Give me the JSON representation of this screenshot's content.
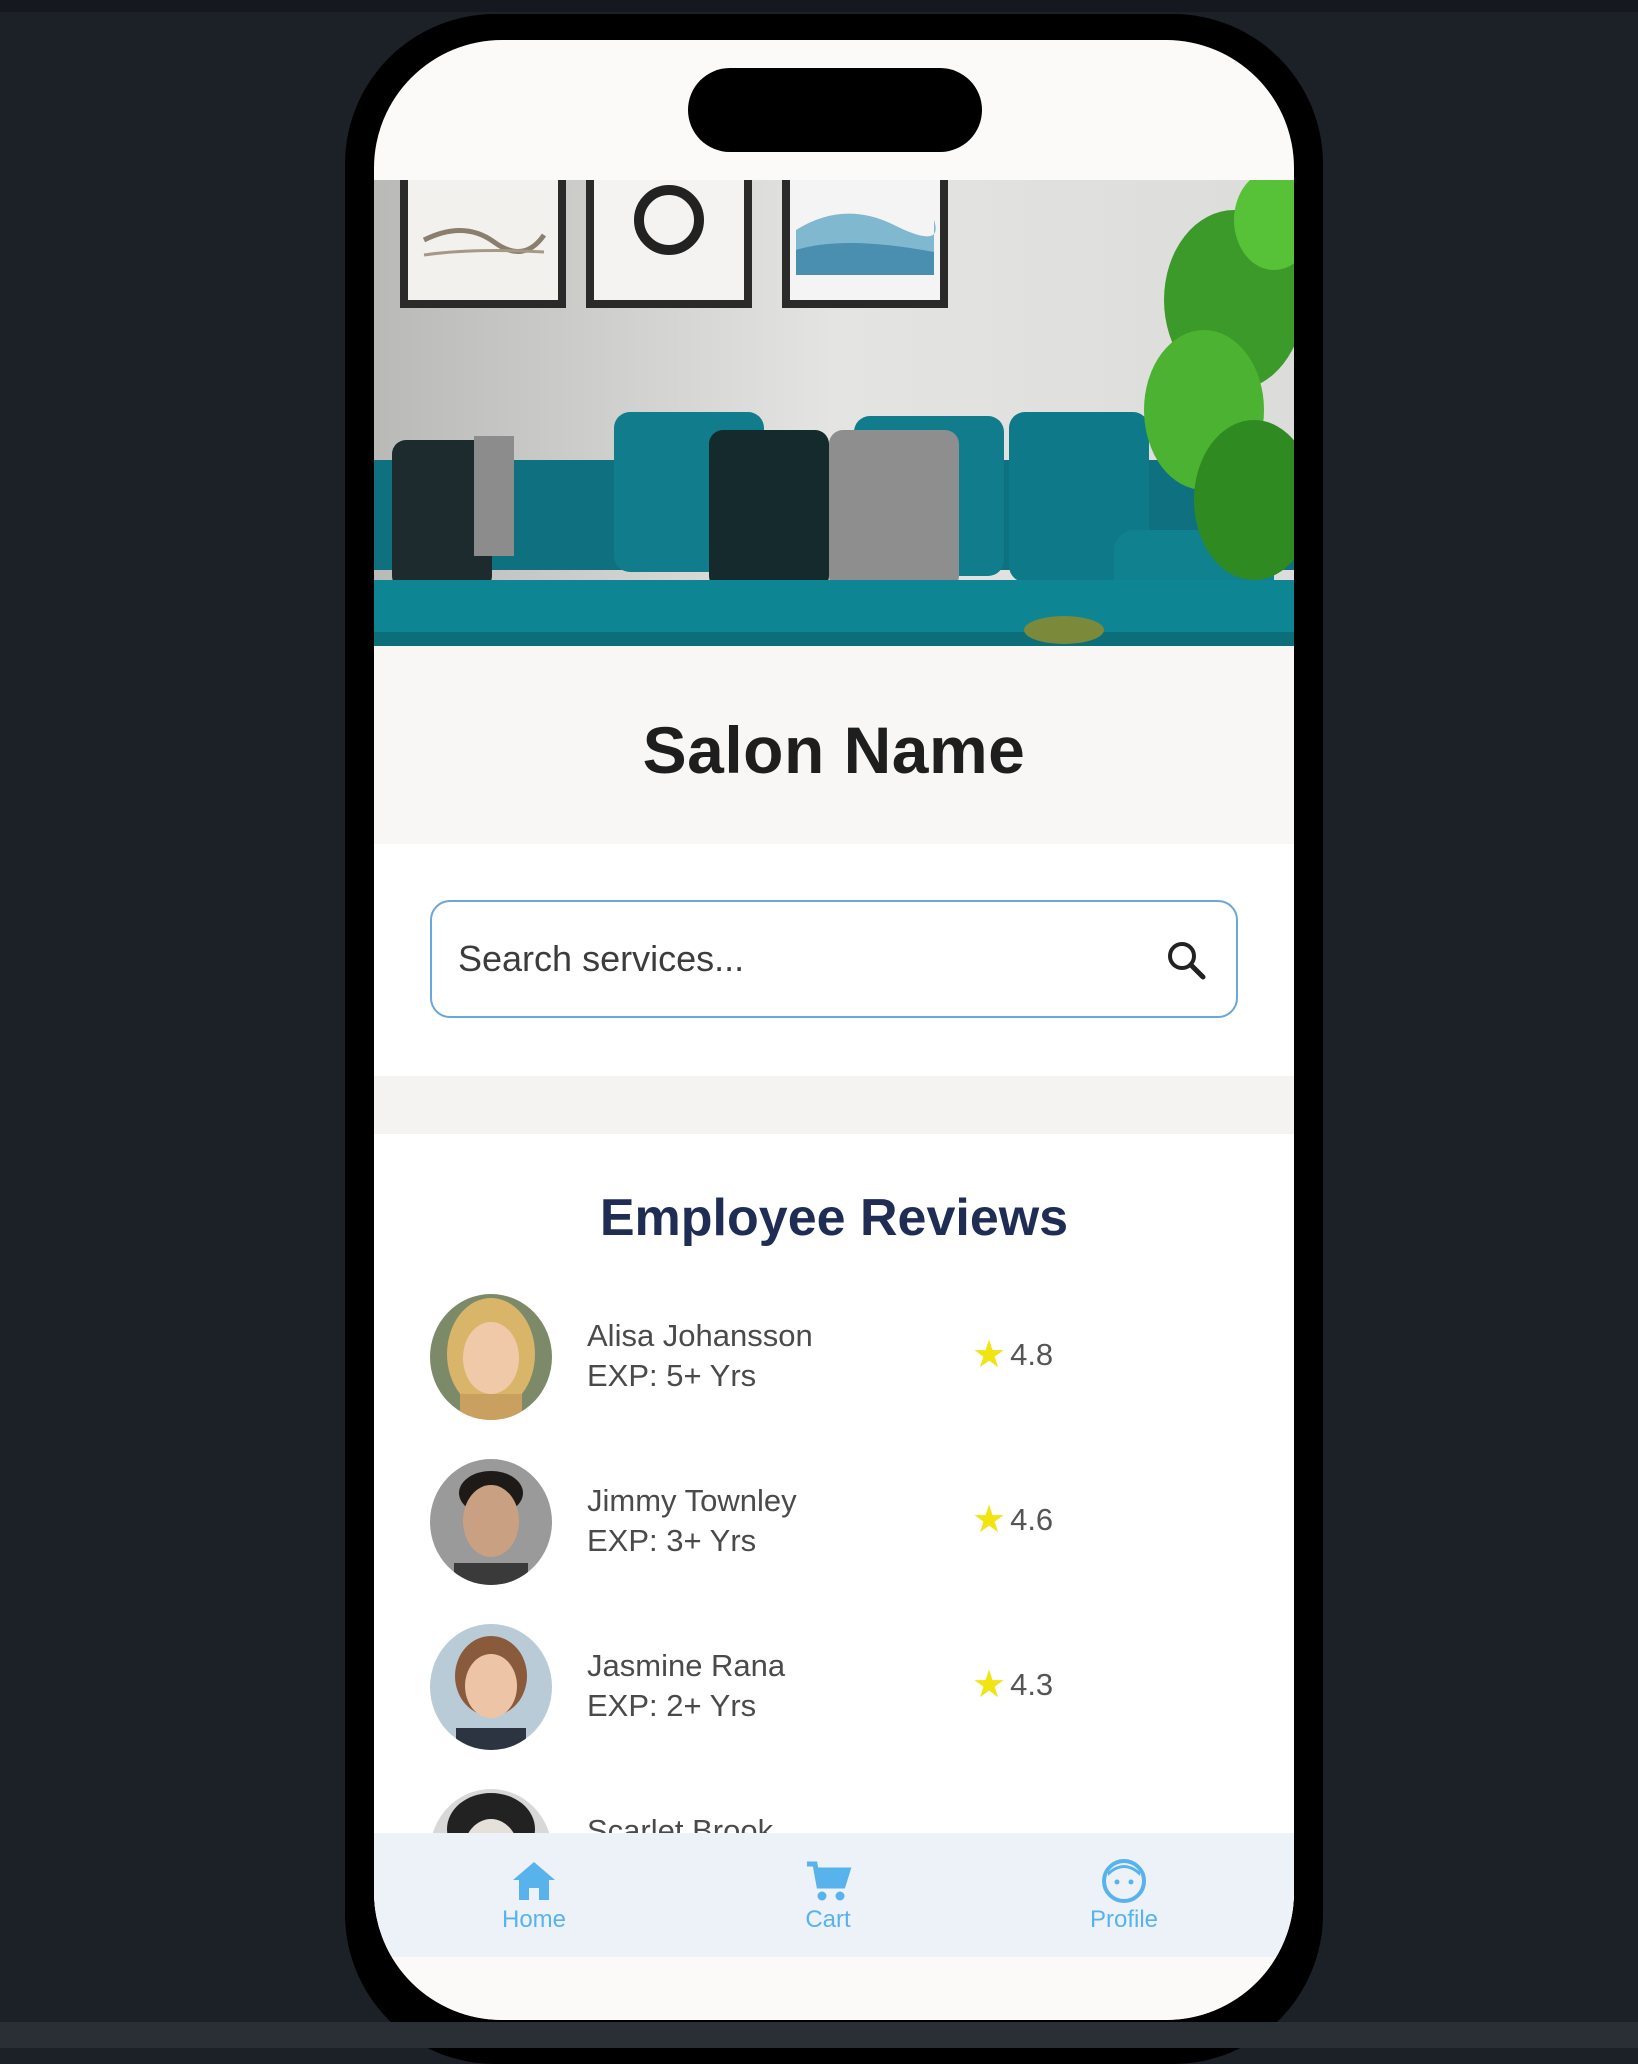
{
  "salon": {
    "name": "Salon Name"
  },
  "search": {
    "placeholder": "Search services..."
  },
  "reviews": {
    "title": "Employee Reviews",
    "employees": [
      {
        "name": "Alisa Johansson",
        "experience": "EXP: 5+ Yrs",
        "rating": "4.8"
      },
      {
        "name": "Jimmy Townley",
        "experience": "EXP: 3+ Yrs",
        "rating": "4.6"
      },
      {
        "name": "Jasmine Rana",
        "experience": "EXP: 2+ Yrs",
        "rating": "4.3"
      },
      {
        "name": "Scarlet Brook",
        "experience": "",
        "rating": ""
      }
    ]
  },
  "nav": {
    "home": "Home",
    "cart": "Cart",
    "profile": "Profile"
  },
  "icons": {
    "search": "search-icon",
    "star": "star-icon",
    "home": "home-icon",
    "cart": "cart-icon",
    "profile": "profile-icon"
  },
  "colors": {
    "accent": "#58b3ec",
    "title": "#1f2d55",
    "star": "#f2e313",
    "search_border": "#6aa6d8"
  }
}
